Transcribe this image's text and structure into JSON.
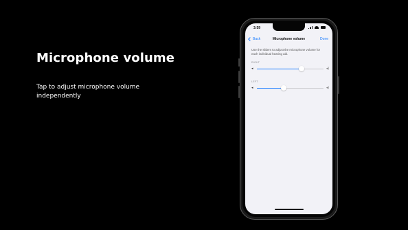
{
  "slide": {
    "title": "Microphone volume",
    "subtitle": "Tap to adjust microphone volume independently"
  },
  "phone": {
    "status_bar": {
      "time": "3:59",
      "icons": [
        "cellular-signal-icon",
        "wifi-icon",
        "battery-icon"
      ]
    },
    "nav": {
      "back_label": "Back",
      "title": "Microphone volume",
      "done_label": "Done"
    },
    "description": "Use the sliders to adjust the microphone volume for each individual hearing aid.",
    "sliders": [
      {
        "label": "RIGHT",
        "value_fraction": 0.67
      },
      {
        "label": "LEFT",
        "value_fraction": 0.4
      }
    ],
    "colors": {
      "accent": "#1a7cff",
      "screen_background": "#f2f2f7",
      "slide_background": "#000000"
    }
  }
}
